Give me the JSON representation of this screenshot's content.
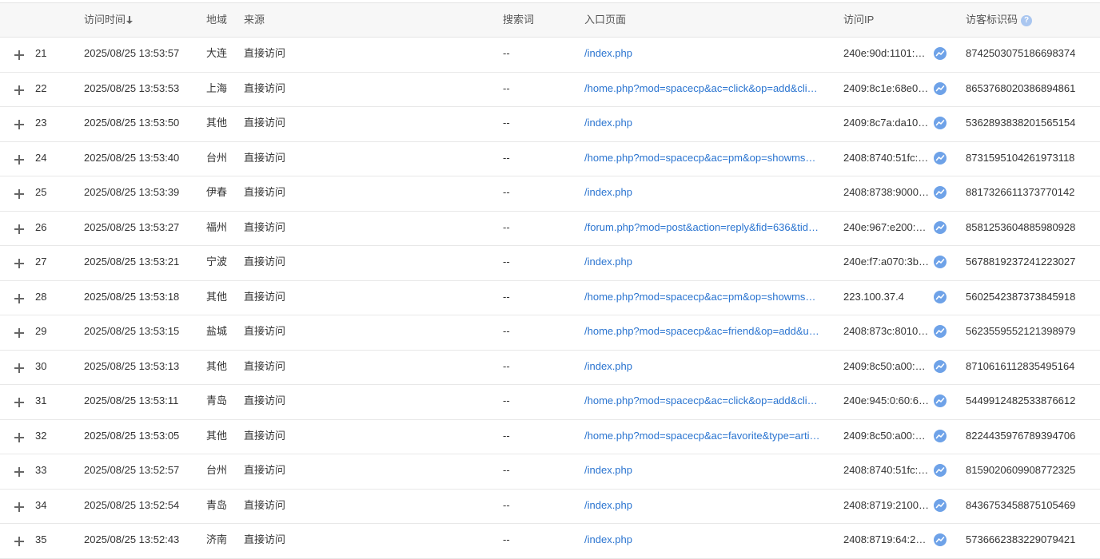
{
  "header": {
    "time": "访问时间",
    "region": "地域",
    "source": "来源",
    "search": "搜索词",
    "page": "入口页面",
    "ip": "访问IP",
    "visitor_id": "访客标识码",
    "help": "?"
  },
  "rows": [
    {
      "num": "21",
      "time": "2025/08/25 13:53:57",
      "region": "大连",
      "source": "直接访问",
      "search": "--",
      "page": "/index.php",
      "ip": "240e:90d:1101:…",
      "vid": "8742503075186698374"
    },
    {
      "num": "22",
      "time": "2025/08/25 13:53:53",
      "region": "上海",
      "source": "直接访问",
      "search": "--",
      "page": "/home.php?mod=spacecp&ac=click&op=add&cli…",
      "ip": "2409:8c1e:68e0…",
      "vid": "8653768020386894861"
    },
    {
      "num": "23",
      "time": "2025/08/25 13:53:50",
      "region": "其他",
      "source": "直接访问",
      "search": "--",
      "page": "/index.php",
      "ip": "2409:8c7a:da10…",
      "vid": "5362893838201565154"
    },
    {
      "num": "24",
      "time": "2025/08/25 13:53:40",
      "region": "台州",
      "source": "直接访问",
      "search": "--",
      "page": "/home.php?mod=spacecp&ac=pm&op=showms…",
      "ip": "2408:8740:51fc:…",
      "vid": "8731595104261973118"
    },
    {
      "num": "25",
      "time": "2025/08/25 13:53:39",
      "region": "伊春",
      "source": "直接访问",
      "search": "--",
      "page": "/index.php",
      "ip": "2408:8738:9000…",
      "vid": "8817326611373770142"
    },
    {
      "num": "26",
      "time": "2025/08/25 13:53:27",
      "region": "福州",
      "source": "直接访问",
      "search": "--",
      "page": "/forum.php?mod=post&action=reply&fid=636&tid…",
      "ip": "240e:967:e200:…",
      "vid": "8581253604885980928"
    },
    {
      "num": "27",
      "time": "2025/08/25 13:53:21",
      "region": "宁波",
      "source": "直接访问",
      "search": "--",
      "page": "/index.php",
      "ip": "240e:f7:a070:3b…",
      "vid": "5678819237241223027"
    },
    {
      "num": "28",
      "time": "2025/08/25 13:53:18",
      "region": "其他",
      "source": "直接访问",
      "search": "--",
      "page": "/home.php?mod=spacecp&ac=pm&op=showms…",
      "ip": "223.100.37.4",
      "vid": "5602542387373845918"
    },
    {
      "num": "29",
      "time": "2025/08/25 13:53:15",
      "region": "盐城",
      "source": "直接访问",
      "search": "--",
      "page": "/home.php?mod=spacecp&ac=friend&op=add&u…",
      "ip": "2408:873c:8010…",
      "vid": "5623559552121398979"
    },
    {
      "num": "30",
      "time": "2025/08/25 13:53:13",
      "region": "其他",
      "source": "直接访问",
      "search": "--",
      "page": "/index.php",
      "ip": "2409:8c50:a00:…",
      "vid": "8710616112835495164"
    },
    {
      "num": "31",
      "time": "2025/08/25 13:53:11",
      "region": "青岛",
      "source": "直接访问",
      "search": "--",
      "page": "/home.php?mod=spacecp&ac=click&op=add&cli…",
      "ip": "240e:945:0:60:6…",
      "vid": "5449912482533876612"
    },
    {
      "num": "32",
      "time": "2025/08/25 13:53:05",
      "region": "其他",
      "source": "直接访问",
      "search": "--",
      "page": "/home.php?mod=spacecp&ac=favorite&type=arti…",
      "ip": "2409:8c50:a00:…",
      "vid": "8224435976789394706"
    },
    {
      "num": "33",
      "time": "2025/08/25 13:52:57",
      "region": "台州",
      "source": "直接访问",
      "search": "--",
      "page": "/index.php",
      "ip": "2408:8740:51fc:…",
      "vid": "8159020609908772325"
    },
    {
      "num": "34",
      "time": "2025/08/25 13:52:54",
      "region": "青岛",
      "source": "直接访问",
      "search": "--",
      "page": "/index.php",
      "ip": "2408:8719:2100…",
      "vid": "8436753458875105469"
    },
    {
      "num": "35",
      "time": "2025/08/25 13:52:43",
      "region": "济南",
      "source": "直接访问",
      "search": "--",
      "page": "/index.php",
      "ip": "2408:8719:64:2…",
      "vid": "5736662383229079421"
    }
  ]
}
